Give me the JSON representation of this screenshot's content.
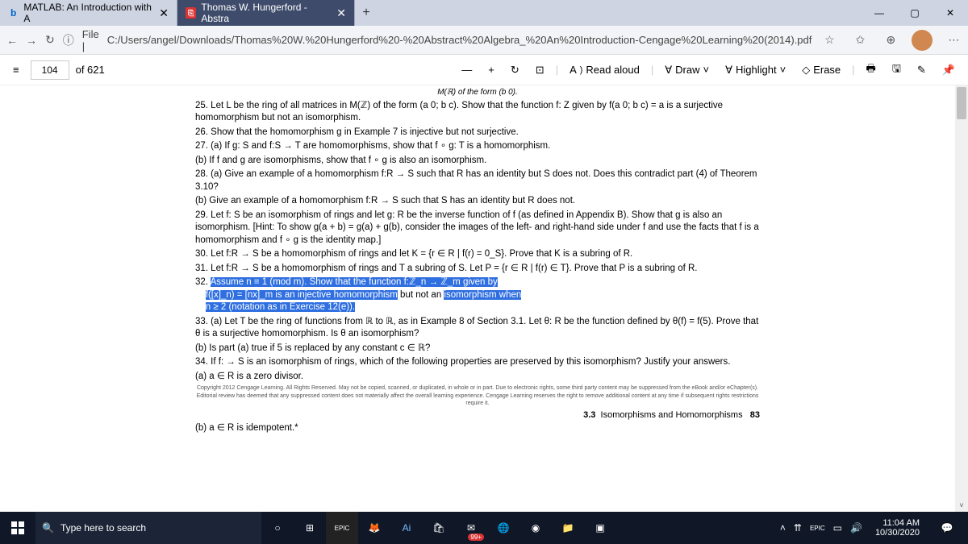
{
  "tabs": [
    {
      "fav": "b",
      "favColor": "#0066cc",
      "label": "MATLAB: An Introduction with A",
      "active": false
    },
    {
      "fav": "⎘",
      "favColor": "#d33",
      "label": "Thomas W. Hungerford - Abstra",
      "active": true
    }
  ],
  "window": {
    "min": "—",
    "max": "▢",
    "close": "✕"
  },
  "addr": {
    "back": "←",
    "fwd": "→",
    "refresh": "↻",
    "info": "ⓘ",
    "prefix": "File | ",
    "path": "C:/Users/angel/Downloads/Thomas%20W.%20Hungerford%20-%20Abstract%20Algebra_%20An%20Introduction-Cengage%20Learning%20(2014).pdf",
    "star": "☆",
    "fav": "✩",
    "collection": "⊕",
    "profile": "👤",
    "more": "⋯"
  },
  "toolbar": {
    "menu": "≡",
    "page": "104",
    "of": "of 621",
    "zoomOut": "—",
    "zoomIn": "+",
    "rotate": "↻",
    "fit": "⊡",
    "readAloud": "Read aloud",
    "draw": "Draw",
    "highlight": "Highlight",
    "erase": "Erase"
  },
  "doc": {
    "topline": "M(ℝ) of the form (b 0).",
    "ex25": "25. Let L be the ring of all matrices in M(ℤ) of the form (a 0; b c). Show that the function f: Z given by f(a 0; b c) = a is a surjective homomorphism but not an isomorphism.",
    "ex26": "26. Show that the homomorphism g in Example 7 is injective but not surjective.",
    "ex27a": "27. (a) If g: S and f:S → T are homomorphisms, show that f ∘ g: T is a homomorphism.",
    "ex27b": "(b) If f and g are isomorphisms, show that f ∘ g is also an isomorphism.",
    "ex28a": "28. (a) Give an example of a homomorphism f:R → S such that R has an identity but S does not. Does this contradict part (4) of Theorem 3.10?",
    "ex28b": "(b) Give an example of a homomorphism f:R → S such that S has an identity but R does not.",
    "ex29": "29. Let f: S be an isomorphism of rings and let g: R be the inverse function of f (as defined in Appendix B). Show that g is also an isomorphism. [Hint: To show g(a + b) = g(a) + g(b), consider the images of the left- and right-hand side under f and use the facts that f is a homomorphism and f ∘ g is the identity map.]",
    "ex30": "30. Let f:R → S be a homomorphism of rings and let K = {r ∈ R | f(r) = 0_S}. Prove that K is a subring of R.",
    "ex31": "31. Let f:R → S be a homomorphism of rings and T a subring of S. Let P = {r ∈ R | f(r) ∈ T}. Prove that P is a subring of R.",
    "ex32_pre": "32. ",
    "ex32_hl1": "Assume n ≡ 1 (mod m). Show that the function f:ℤ_n → ℤ_m given by",
    "ex32_hl2": "f([x]_n) = [nx]_m is an injective homomorphism",
    "ex32_mid": " but not an ",
    "ex32_hl3": "isomorphism when",
    "ex32_line3": "n ≥ 2 (notation as in Exercise 12(e)).",
    "ex33a": "33. (a) Let T be the ring of functions from ℝ to ℝ, as in Example 8 of Section 3.1. Let θ: R be the function defined by θ(f) = f(5). Prove that θ is a surjective homomorphism. Is θ an isomorphism?",
    "ex33b": "(b) Is part (a) true if 5 is replaced by any constant c ∈ ℝ?",
    "ex34": "34. If f: → S is an isomorphism of rings, which of the following properties are preserved by this isomorphism? Justify your answers.",
    "ex34a": "(a) a ∈ R is a zero divisor.",
    "copyright": "Copyright 2012 Cengage Learning. All Rights Reserved. May not be copied, scanned, or duplicated, in whole or in part. Due to electronic rights, some third party content may be suppressed from the eBook and/or eChapter(s). Editorial review has deemed that any suppressed content does not materially affect the overall learning experience. Cengage Learning reserves the right to remove additional content at any time if subsequent rights restrictions require it.",
    "sectionNum": "3.3",
    "sectionTitle": "Isomorphisms and Homomorphisms",
    "pageNum": "83",
    "ex34b": "(b) a ∈ R is idempotent.*"
  },
  "taskbar": {
    "search": "Type here to search",
    "mailBadge": "99+",
    "time": "11:04 AM",
    "date": "10/30/2020"
  }
}
